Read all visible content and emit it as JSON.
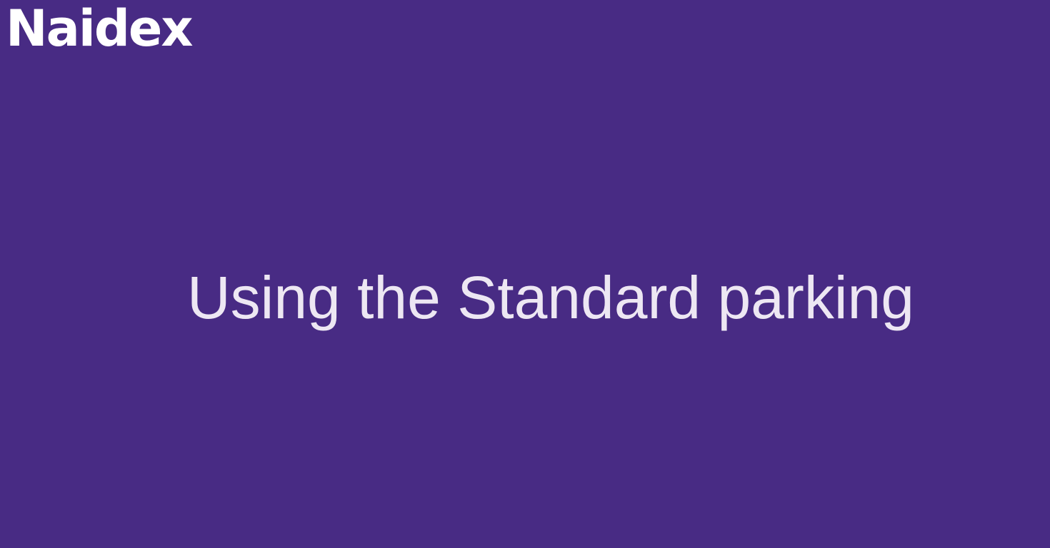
{
  "brand": {
    "logo_text": "Naidex"
  },
  "slide": {
    "title": "Using the Standard parking"
  },
  "colors": {
    "background": "#482b84",
    "logo": "#ffffff",
    "title": "#ede7f3"
  }
}
